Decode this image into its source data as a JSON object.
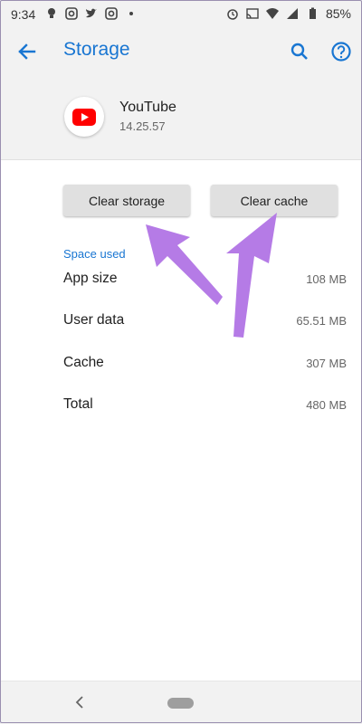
{
  "status_bar": {
    "time": "9:34",
    "battery": "85%"
  },
  "app_bar": {
    "title": "Storage"
  },
  "app": {
    "name": "YouTube",
    "version": "14.25.57"
  },
  "buttons": {
    "clear_storage": "Clear storage",
    "clear_cache": "Clear cache"
  },
  "space_used": {
    "label": "Space used",
    "rows": [
      {
        "label": "App size",
        "value": "108 MB"
      },
      {
        "label": "User data",
        "value": "65.51 MB"
      },
      {
        "label": "Cache",
        "value": "307 MB"
      },
      {
        "label": "Total",
        "value": "480 MB"
      }
    ]
  },
  "colors": {
    "accent": "#1976d2",
    "annotation_arrow": "#b57be6",
    "youtube_red": "#ff0000"
  },
  "icons": {
    "status_left": [
      "bulb-icon",
      "instagram-icon",
      "twitter-icon",
      "instagram-icon",
      "dot-icon"
    ],
    "status_right": [
      "alarm-icon",
      "cast-icon",
      "wifi-icon",
      "signal-icon",
      "battery-icon"
    ],
    "app_bar": [
      "back-arrow-icon",
      "search-icon",
      "help-icon"
    ],
    "nav_bar": [
      "nav-back-icon",
      "nav-home-pill"
    ]
  }
}
